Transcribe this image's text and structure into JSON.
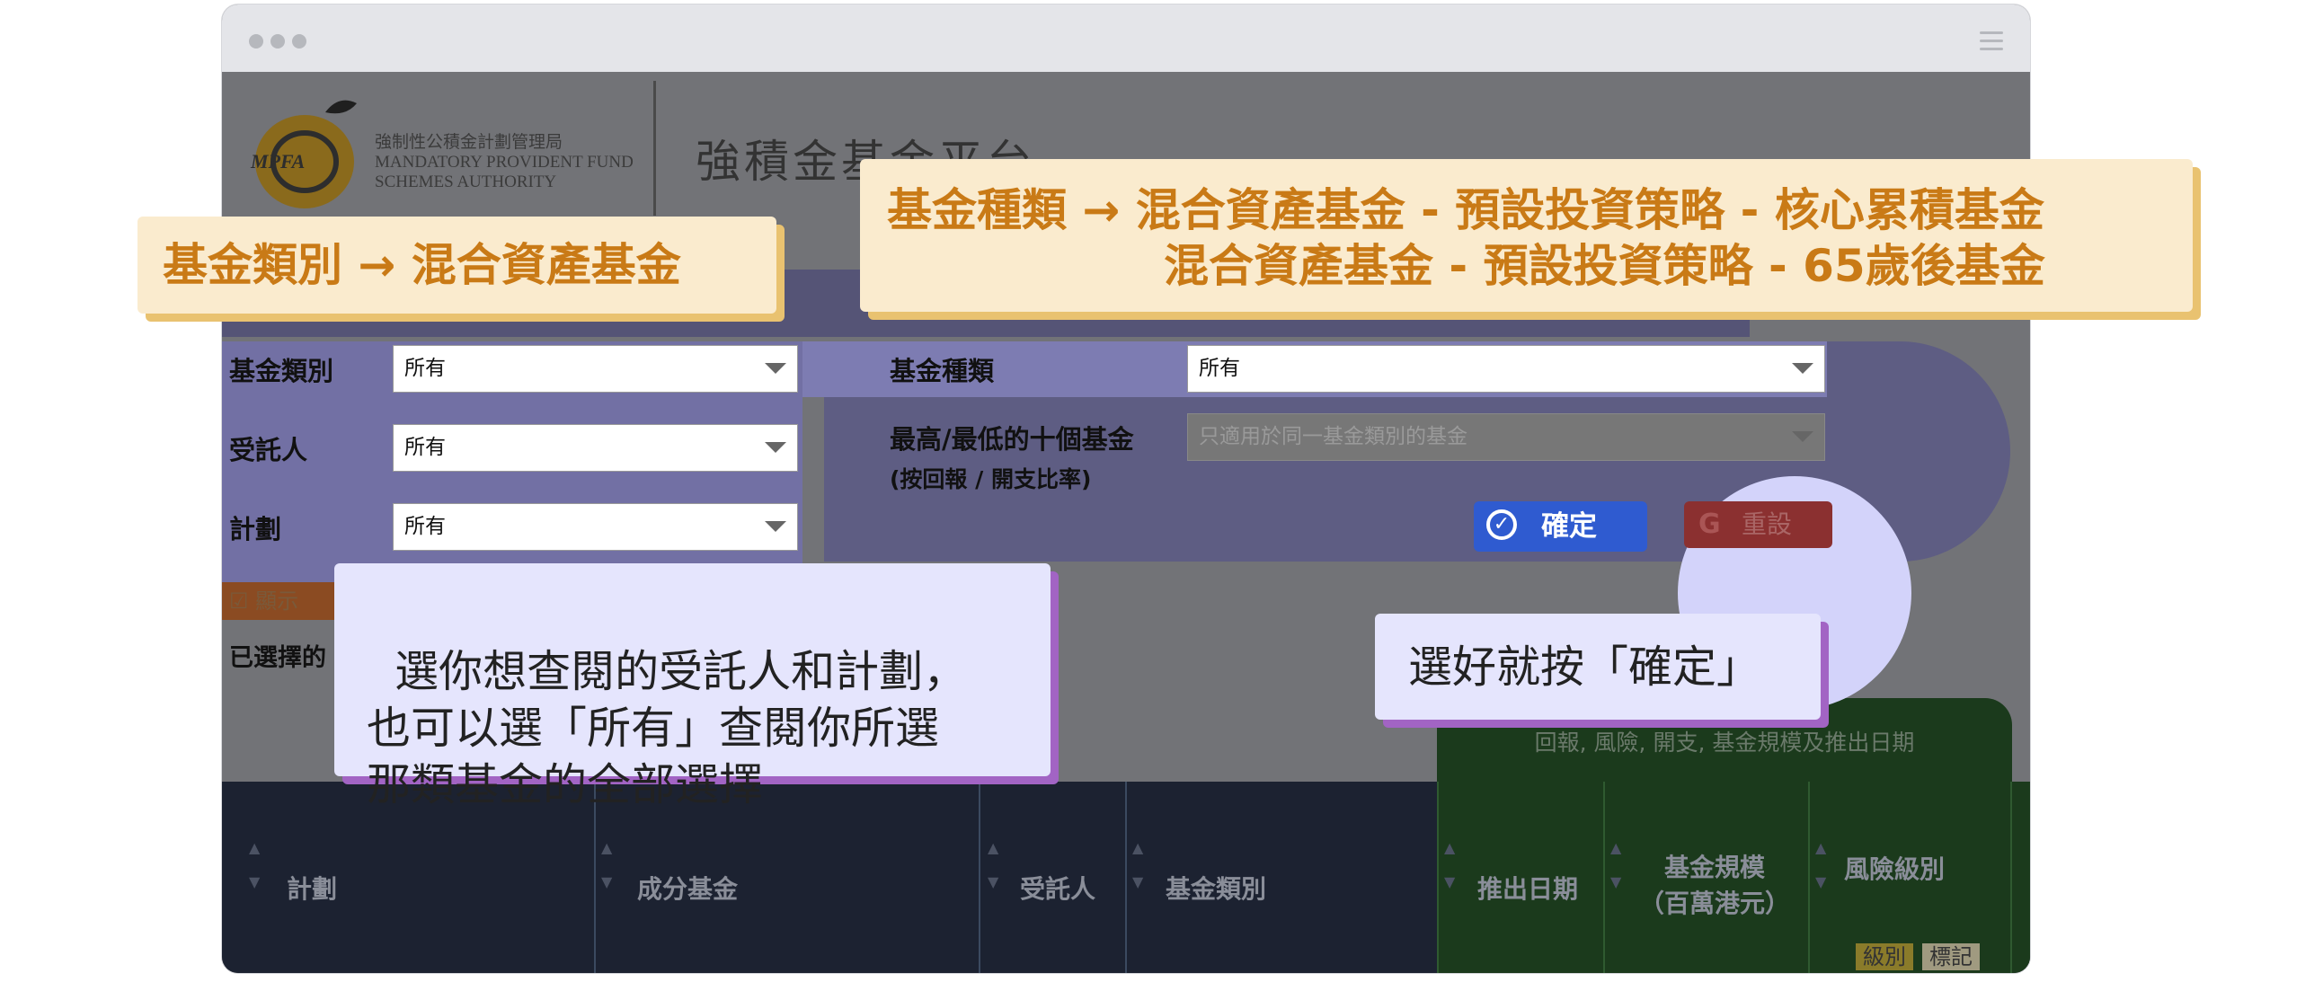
{
  "window": {
    "platform_title": "強積金基金平台",
    "logo_text": "強制性公積金計劃管理局\nMANDATORY PROVIDENT FUND\nSCHEMES AUTHORITY",
    "logo_mark": "MPFA"
  },
  "filters": {
    "fund_category_label": "基金類別",
    "fund_category_value": "所有",
    "fund_type_label": "基金種類",
    "fund_type_value": "所有",
    "trustee_label": "受託人",
    "trustee_value": "所有",
    "scheme_label": "計劃",
    "scheme_value": "所有",
    "top_bottom_label": "最高/最低的十個基金",
    "top_bottom_sub": "(按回報 / 開支比率)",
    "top_bottom_placeholder": "只適用於同一基金類別的基金",
    "confirm_label": "確定",
    "reset_label": "重設",
    "show_label": "顯示",
    "selected_label": "已選擇的"
  },
  "table": {
    "group_header": "回報, 風險, 開支, 基金規模及推出日期",
    "columns": [
      "計劃",
      "成分基金",
      "受託人",
      "基金類別",
      "推出日期",
      "基金規模\n（百萬港元）",
      "風險級別"
    ],
    "risk_badges": [
      "級別",
      "標記"
    ]
  },
  "callouts": {
    "category": "基金類別 → 混合資產基金",
    "type_line1": "基金種類 → 混合資產基金 - 預設投資策略 - 核心累積基金",
    "type_line2": "混合資產基金 - 預設投資策略 - 65歲後基金",
    "trustee_scheme": "選你想查閱的受託人和計劃，\n也可以選「所有」查閱你所選\n那類基金的全部選擇",
    "confirm_hint": "選好就按「確定」"
  },
  "colors": {
    "orange_callout_bg": "#faebce",
    "orange_callout_text": "#c97a16",
    "lavender_callout_bg": "#e5e5fd",
    "confirm_button": "#2f5bd0",
    "reset_button": "#8b3030"
  }
}
